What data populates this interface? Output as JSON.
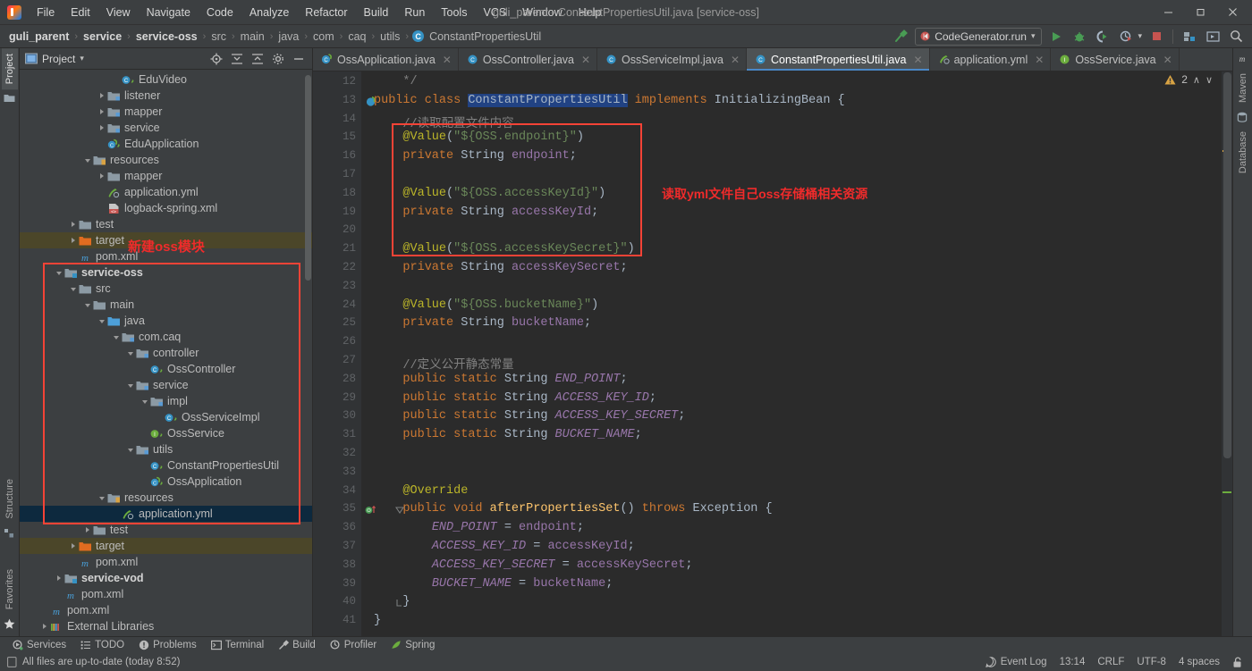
{
  "window": {
    "title": "guli_parent - ConstantPropertiesUtil.java [service-oss]",
    "minimize": "─",
    "maximize": "❐",
    "close": "✕"
  },
  "menubar": {
    "items": [
      {
        "label": "File"
      },
      {
        "label": "Edit"
      },
      {
        "label": "View"
      },
      {
        "label": "Navigate"
      },
      {
        "label": "Code"
      },
      {
        "label": "Analyze"
      },
      {
        "label": "Refactor"
      },
      {
        "label": "Build"
      },
      {
        "label": "Run"
      },
      {
        "label": "Tools"
      },
      {
        "label": "VCS"
      },
      {
        "label": "Window"
      },
      {
        "label": "Help"
      }
    ]
  },
  "breadcrumb": {
    "items": [
      {
        "label": "guli_parent",
        "bold": true
      },
      {
        "label": "service",
        "bold": true
      },
      {
        "label": "service-oss",
        "bold": true
      },
      {
        "label": "src",
        "bold": false
      },
      {
        "label": "main",
        "bold": false
      },
      {
        "label": "java",
        "bold": false
      },
      {
        "label": "com",
        "bold": false
      },
      {
        "label": "caq",
        "bold": false
      },
      {
        "label": "utils",
        "bold": false
      }
    ],
    "class_item": "ConstantPropertiesUtil",
    "class_badge": "C",
    "separator": "›"
  },
  "toolbar": {
    "build_icon": "hammer-icon",
    "run_config": "CodeGenerator.run",
    "run_config_caret": "▾",
    "run_icon": "run-icon",
    "debug_icon": "debug-icon",
    "run_coverage_icon": "run-with-coverage-icon",
    "profile_icon": "profile-icon",
    "profile_caret": "▾",
    "stop_icon": "stop-icon",
    "project_structure_icon": "project-structure-icon",
    "updates_icon": "updates-icon",
    "search_icon": "search-everywhere-icon"
  },
  "project_panel": {
    "title": "Project",
    "title_caret": "▾",
    "actions": [
      "locate-icon",
      "expand-all-icon",
      "collapse-all-icon",
      "settings-gear-icon",
      "hide-icon"
    ],
    "tree": [
      {
        "label": "EduVideo",
        "indent": 6,
        "icon": "class",
        "toggle": "none"
      },
      {
        "label": "listener",
        "indent": 5,
        "icon": "package",
        "toggle": "closed"
      },
      {
        "label": "mapper",
        "indent": 5,
        "icon": "package",
        "toggle": "closed"
      },
      {
        "label": "service",
        "indent": 5,
        "icon": "package",
        "toggle": "closed"
      },
      {
        "label": "EduApplication",
        "indent": 5,
        "icon": "springclass",
        "toggle": "none"
      },
      {
        "label": "resources",
        "indent": 4,
        "icon": "resources",
        "toggle": "open"
      },
      {
        "label": "mapper",
        "indent": 5,
        "icon": "folder",
        "toggle": "closed"
      },
      {
        "label": "application.yml",
        "indent": 5,
        "icon": "yml",
        "toggle": "none"
      },
      {
        "label": "logback-spring.xml",
        "indent": 5,
        "icon": "xml",
        "toggle": "none"
      },
      {
        "label": "test",
        "indent": 3,
        "icon": "folder",
        "toggle": "closed"
      },
      {
        "label": "target",
        "indent": 3,
        "icon": "target",
        "toggle": "closed",
        "highlight": "target"
      },
      {
        "label": "pom.xml",
        "indent": 3,
        "icon": "maven",
        "toggle": "none"
      },
      {
        "label": "service-oss",
        "indent": 2,
        "icon": "module",
        "toggle": "open",
        "bold": true
      },
      {
        "label": "src",
        "indent": 3,
        "icon": "folder",
        "toggle": "open"
      },
      {
        "label": "main",
        "indent": 4,
        "icon": "folder",
        "toggle": "open"
      },
      {
        "label": "java",
        "indent": 5,
        "icon": "source",
        "toggle": "open"
      },
      {
        "label": "com.caq",
        "indent": 6,
        "icon": "package",
        "toggle": "open"
      },
      {
        "label": "controller",
        "indent": 7,
        "icon": "package",
        "toggle": "open"
      },
      {
        "label": "OssController",
        "indent": 8,
        "icon": "class",
        "toggle": "none"
      },
      {
        "label": "service",
        "indent": 7,
        "icon": "package",
        "toggle": "open"
      },
      {
        "label": "impl",
        "indent": 8,
        "icon": "package",
        "toggle": "open"
      },
      {
        "label": "OssServiceImpl",
        "indent": 9,
        "icon": "class",
        "toggle": "none"
      },
      {
        "label": "OssService",
        "indent": 8,
        "icon": "interface",
        "toggle": "none"
      },
      {
        "label": "utils",
        "indent": 7,
        "icon": "package",
        "toggle": "open"
      },
      {
        "label": "ConstantPropertiesUtil",
        "indent": 8,
        "icon": "class",
        "toggle": "none"
      },
      {
        "label": "OssApplication",
        "indent": 8,
        "icon": "springclass",
        "toggle": "none"
      },
      {
        "label": "resources",
        "indent": 5,
        "icon": "resources",
        "toggle": "open"
      },
      {
        "label": "application.yml",
        "indent": 6,
        "icon": "yml",
        "toggle": "none",
        "selected": true
      },
      {
        "label": "test",
        "indent": 4,
        "icon": "folder",
        "toggle": "closed"
      },
      {
        "label": "target",
        "indent": 3,
        "icon": "target",
        "toggle": "closed",
        "highlight": "target"
      },
      {
        "label": "pom.xml",
        "indent": 3,
        "icon": "maven",
        "toggle": "none"
      },
      {
        "label": "service-vod",
        "indent": 2,
        "icon": "module",
        "toggle": "closed",
        "bold": true
      },
      {
        "label": "pom.xml",
        "indent": 2,
        "icon": "maven",
        "toggle": "none"
      },
      {
        "label": "pom.xml",
        "indent": 1,
        "icon": "maven",
        "toggle": "none"
      },
      {
        "label": "External Libraries",
        "indent": 1,
        "icon": "library",
        "toggle": "closed"
      }
    ]
  },
  "annotations": {
    "tree_note": "新建oss模块",
    "code_note": "读取yml文件自己oss存储桶相关资源",
    "color": "#f02b2b"
  },
  "left_strip": {
    "tabs": [
      {
        "label": "Project",
        "active": true
      },
      {
        "label": "Structure",
        "active": false
      },
      {
        "label": "Favorites",
        "active": false
      }
    ]
  },
  "right_strip": {
    "tabs": [
      {
        "label": "Maven",
        "active": false
      },
      {
        "label": "Database",
        "active": false
      }
    ]
  },
  "editor_tabs": [
    {
      "label": "OssApplication.java",
      "icon": "spring-class",
      "active": false
    },
    {
      "label": "OssController.java",
      "icon": "class",
      "active": false
    },
    {
      "label": "OssServiceImpl.java",
      "icon": "class",
      "active": false
    },
    {
      "label": "ConstantPropertiesUtil.java",
      "icon": "class",
      "active": true
    },
    {
      "label": "application.yml",
      "icon": "yml",
      "active": false
    },
    {
      "label": "OssService.java",
      "icon": "interface",
      "active": false
    }
  ],
  "inspection": {
    "warning_count": "2",
    "warning_icon": "warning-triangle-icon",
    "prev": "∧",
    "next": "∨"
  },
  "editor": {
    "first_line": 12,
    "lines": [
      {
        "n": 12,
        "tokens": [
          {
            "t": "    ",
            "c": ""
          },
          {
            "t": "*/",
            "c": "cmt"
          }
        ]
      },
      {
        "n": 13,
        "gutter_mark": "spring-bean",
        "tokens": [
          {
            "t": "public ",
            "c": "kw"
          },
          {
            "t": "class ",
            "c": "kw"
          },
          {
            "t": "ConstantPropertiesUtil",
            "c": "sel"
          },
          {
            "t": " ",
            "c": ""
          },
          {
            "t": "implements ",
            "c": "kw"
          },
          {
            "t": "InitializingBean",
            "c": "cls"
          },
          {
            "t": " {",
            "c": ""
          }
        ]
      },
      {
        "n": 14,
        "tokens": [
          {
            "t": "    //读取配置文件内容",
            "c": "cmt"
          }
        ]
      },
      {
        "n": 15,
        "tokens": [
          {
            "t": "    ",
            "c": ""
          },
          {
            "t": "@Value",
            "c": "ann"
          },
          {
            "t": "(",
            "c": ""
          },
          {
            "t": "\"${OSS.endpoint}\"",
            "c": "str"
          },
          {
            "t": ")",
            "c": ""
          }
        ]
      },
      {
        "n": 16,
        "tokens": [
          {
            "t": "    ",
            "c": ""
          },
          {
            "t": "private ",
            "c": "kw"
          },
          {
            "t": "String ",
            "c": "cls"
          },
          {
            "t": "endpoint",
            "c": "fld"
          },
          {
            "t": ";",
            "c": ""
          }
        ]
      },
      {
        "n": 17,
        "tokens": []
      },
      {
        "n": 18,
        "tokens": [
          {
            "t": "    ",
            "c": ""
          },
          {
            "t": "@Value",
            "c": "ann"
          },
          {
            "t": "(",
            "c": ""
          },
          {
            "t": "\"${OSS.accessKeyId}\"",
            "c": "str"
          },
          {
            "t": ")",
            "c": ""
          }
        ]
      },
      {
        "n": 19,
        "tokens": [
          {
            "t": "    ",
            "c": ""
          },
          {
            "t": "private ",
            "c": "kw"
          },
          {
            "t": "String ",
            "c": "cls"
          },
          {
            "t": "accessKeyId",
            "c": "fld"
          },
          {
            "t": ";",
            "c": ""
          }
        ]
      },
      {
        "n": 20,
        "tokens": []
      },
      {
        "n": 21,
        "tokens": [
          {
            "t": "    ",
            "c": ""
          },
          {
            "t": "@Value",
            "c": "ann"
          },
          {
            "t": "(",
            "c": ""
          },
          {
            "t": "\"${OSS.accessKeySecret}\"",
            "c": "str"
          },
          {
            "t": ")",
            "c": ""
          }
        ]
      },
      {
        "n": 22,
        "tokens": [
          {
            "t": "    ",
            "c": ""
          },
          {
            "t": "private ",
            "c": "kw"
          },
          {
            "t": "String ",
            "c": "cls"
          },
          {
            "t": "accessKeySecret",
            "c": "fld"
          },
          {
            "t": ";",
            "c": ""
          }
        ]
      },
      {
        "n": 23,
        "tokens": []
      },
      {
        "n": 24,
        "tokens": [
          {
            "t": "    ",
            "c": ""
          },
          {
            "t": "@Value",
            "c": "ann"
          },
          {
            "t": "(",
            "c": ""
          },
          {
            "t": "\"${OSS.bucketName}\"",
            "c": "str"
          },
          {
            "t": ")",
            "c": ""
          }
        ]
      },
      {
        "n": 25,
        "tokens": [
          {
            "t": "    ",
            "c": ""
          },
          {
            "t": "private ",
            "c": "kw"
          },
          {
            "t": "String ",
            "c": "cls"
          },
          {
            "t": "bucketName",
            "c": "fld"
          },
          {
            "t": ";",
            "c": ""
          }
        ]
      },
      {
        "n": 26,
        "tokens": []
      },
      {
        "n": 27,
        "tokens": [
          {
            "t": "    //定义公开静态常量",
            "c": "cmt"
          }
        ]
      },
      {
        "n": 28,
        "tokens": [
          {
            "t": "    ",
            "c": ""
          },
          {
            "t": "public static ",
            "c": "kw"
          },
          {
            "t": "String ",
            "c": "cls"
          },
          {
            "t": "END_POINT",
            "c": "stat"
          },
          {
            "t": ";",
            "c": ""
          }
        ]
      },
      {
        "n": 29,
        "tokens": [
          {
            "t": "    ",
            "c": ""
          },
          {
            "t": "public static ",
            "c": "kw"
          },
          {
            "t": "String ",
            "c": "cls"
          },
          {
            "t": "ACCESS_KEY_ID",
            "c": "stat"
          },
          {
            "t": ";",
            "c": ""
          }
        ]
      },
      {
        "n": 30,
        "tokens": [
          {
            "t": "    ",
            "c": ""
          },
          {
            "t": "public static ",
            "c": "kw"
          },
          {
            "t": "String ",
            "c": "cls"
          },
          {
            "t": "ACCESS_KEY_SECRET",
            "c": "stat"
          },
          {
            "t": ";",
            "c": ""
          }
        ]
      },
      {
        "n": 31,
        "tokens": [
          {
            "t": "    ",
            "c": ""
          },
          {
            "t": "public static ",
            "c": "kw"
          },
          {
            "t": "String ",
            "c": "cls"
          },
          {
            "t": "BUCKET_NAME",
            "c": "stat"
          },
          {
            "t": ";",
            "c": ""
          }
        ]
      },
      {
        "n": 32,
        "tokens": []
      },
      {
        "n": 33,
        "tokens": []
      },
      {
        "n": 34,
        "tokens": [
          {
            "t": "    ",
            "c": ""
          },
          {
            "t": "@Override",
            "c": "ann"
          }
        ]
      },
      {
        "n": 35,
        "gutter_mark": "override",
        "fold": true,
        "tokens": [
          {
            "t": "    ",
            "c": ""
          },
          {
            "t": "public void ",
            "c": "kw"
          },
          {
            "t": "afterPropertiesSet",
            "c": "mth"
          },
          {
            "t": "() ",
            "c": ""
          },
          {
            "t": "throws ",
            "c": "kw"
          },
          {
            "t": "Exception",
            "c": "cls"
          },
          {
            "t": " {",
            "c": ""
          }
        ]
      },
      {
        "n": 36,
        "tokens": [
          {
            "t": "        ",
            "c": ""
          },
          {
            "t": "END_POINT",
            "c": "stat"
          },
          {
            "t": " = ",
            "c": ""
          },
          {
            "t": "endpoint",
            "c": "fld"
          },
          {
            "t": ";",
            "c": ""
          }
        ]
      },
      {
        "n": 37,
        "tokens": [
          {
            "t": "        ",
            "c": ""
          },
          {
            "t": "ACCESS_KEY_ID",
            "c": "stat"
          },
          {
            "t": " = ",
            "c": ""
          },
          {
            "t": "accessKeyId",
            "c": "fld"
          },
          {
            "t": ";",
            "c": ""
          }
        ]
      },
      {
        "n": 38,
        "tokens": [
          {
            "t": "        ",
            "c": ""
          },
          {
            "t": "ACCESS_KEY_SECRET",
            "c": "stat"
          },
          {
            "t": " = ",
            "c": ""
          },
          {
            "t": "accessKeySecret",
            "c": "fld"
          },
          {
            "t": ";",
            "c": ""
          }
        ]
      },
      {
        "n": 39,
        "tokens": [
          {
            "t": "        ",
            "c": ""
          },
          {
            "t": "BUCKET_NAME",
            "c": "stat"
          },
          {
            "t": " = ",
            "c": ""
          },
          {
            "t": "bucketName",
            "c": "fld"
          },
          {
            "t": ";",
            "c": ""
          }
        ]
      },
      {
        "n": 40,
        "fold_end": true,
        "tokens": [
          {
            "t": "    }",
            "c": ""
          }
        ]
      },
      {
        "n": 41,
        "tokens": [
          {
            "t": "}",
            "c": ""
          }
        ]
      }
    ]
  },
  "bottom_tools": [
    {
      "label": "Services",
      "icon": "services-icon"
    },
    {
      "label": "TODO",
      "icon": "todo-icon"
    },
    {
      "label": "Problems",
      "icon": "problems-icon"
    },
    {
      "label": "Terminal",
      "icon": "terminal-icon"
    },
    {
      "label": "Build",
      "icon": "build-icon"
    },
    {
      "label": "Profiler",
      "icon": "profiler-icon"
    },
    {
      "label": "Spring",
      "icon": "spring-icon"
    }
  ],
  "status_bar": {
    "message": "All files are up-to-date (today 8:52)",
    "message_icon": "file-icon",
    "event_log": "Event Log",
    "event_log_icon": "event-log-icon",
    "position": "13:14",
    "line_separator": "CRLF",
    "encoding": "UTF-8",
    "indent": "4 spaces",
    "lock_icon": "unlocked-icon"
  }
}
